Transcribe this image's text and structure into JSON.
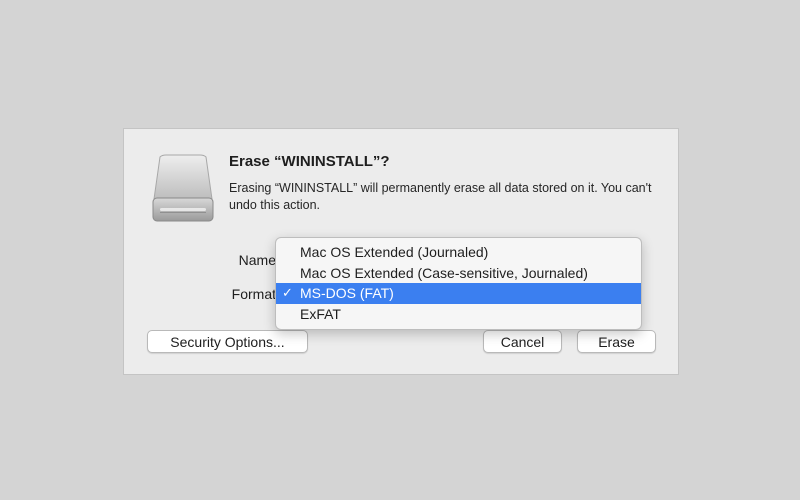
{
  "dialog": {
    "title": "Erase “WININSTALL”?",
    "message": "Erasing “WININSTALL” will permanently erase all data stored on it. You can't undo this action.",
    "name_label": "Name",
    "format_label": "Format",
    "icon": "external-drive-icon"
  },
  "format_menu": {
    "items": [
      {
        "label": "Mac OS Extended (Journaled)",
        "selected": false
      },
      {
        "label": "Mac OS Extended (Case-sensitive, Journaled)",
        "selected": false
      },
      {
        "label": "MS-DOS (FAT)",
        "selected": true
      },
      {
        "label": "ExFAT",
        "selected": false
      }
    ],
    "check_glyph": "✓",
    "highlight_color": "#3b7ff0"
  },
  "buttons": {
    "security_label": "Security Options...",
    "cancel_label": "Cancel",
    "erase_label": "Erase"
  }
}
